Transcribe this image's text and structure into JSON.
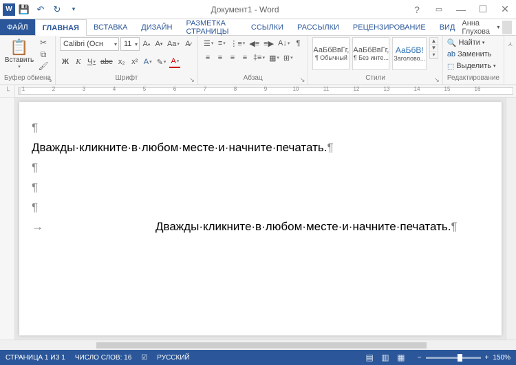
{
  "title": "Документ1 - Word",
  "qat": {
    "save": "💾",
    "undo": "↶",
    "redo": "↻"
  },
  "tabs": {
    "file": "ФАЙЛ",
    "items": [
      "ГЛАВНАЯ",
      "ВСТАВКА",
      "ДИЗАЙН",
      "РАЗМЕТКА СТРАНИЦЫ",
      "ССЫЛКИ",
      "РАССЫЛКИ",
      "РЕЦЕНЗИРОВАНИЕ",
      "ВИД"
    ],
    "active": 0
  },
  "user": {
    "name": "Анна Глухова"
  },
  "ribbon": {
    "clipboard": {
      "label": "Буфер обмена",
      "paste": "Вставить"
    },
    "font": {
      "label": "Шрифт",
      "name": "Calibri (Осн",
      "size": "11",
      "bold": "Ж",
      "italic": "К",
      "underline": "Ч",
      "strike": "abc",
      "sub": "x₂",
      "sup": "x²",
      "aa": "Aa"
    },
    "paragraph": {
      "label": "Абзац"
    },
    "styles": {
      "label": "Стили",
      "items": [
        {
          "sample": "АаБбВвГг,",
          "name": "¶ Обычный"
        },
        {
          "sample": "АаБбВвГг,",
          "name": "¶ Без инте..."
        },
        {
          "sample": "АаБбВ!",
          "name": "Заголово..."
        }
      ]
    },
    "editing": {
      "label": "Редактирование",
      "find": "Найти",
      "replace": "Заменить",
      "select": "Выделить"
    }
  },
  "ruler": {
    "numbers": [
      1,
      2,
      3,
      4,
      5,
      6,
      7,
      8,
      9,
      10,
      11,
      12,
      13,
      14,
      15,
      16
    ]
  },
  "document": {
    "line1": "Дважды·кликните·в·любом·месте·и·начните·печатать.",
    "line2": "Дважды·кликните·в·любом·месте·и·начните·печатать."
  },
  "status": {
    "page": "СТРАНИЦА 1 ИЗ 1",
    "words": "ЧИСЛО СЛОВ: 16",
    "lang": "РУССКИЙ",
    "zoom": "150%"
  }
}
